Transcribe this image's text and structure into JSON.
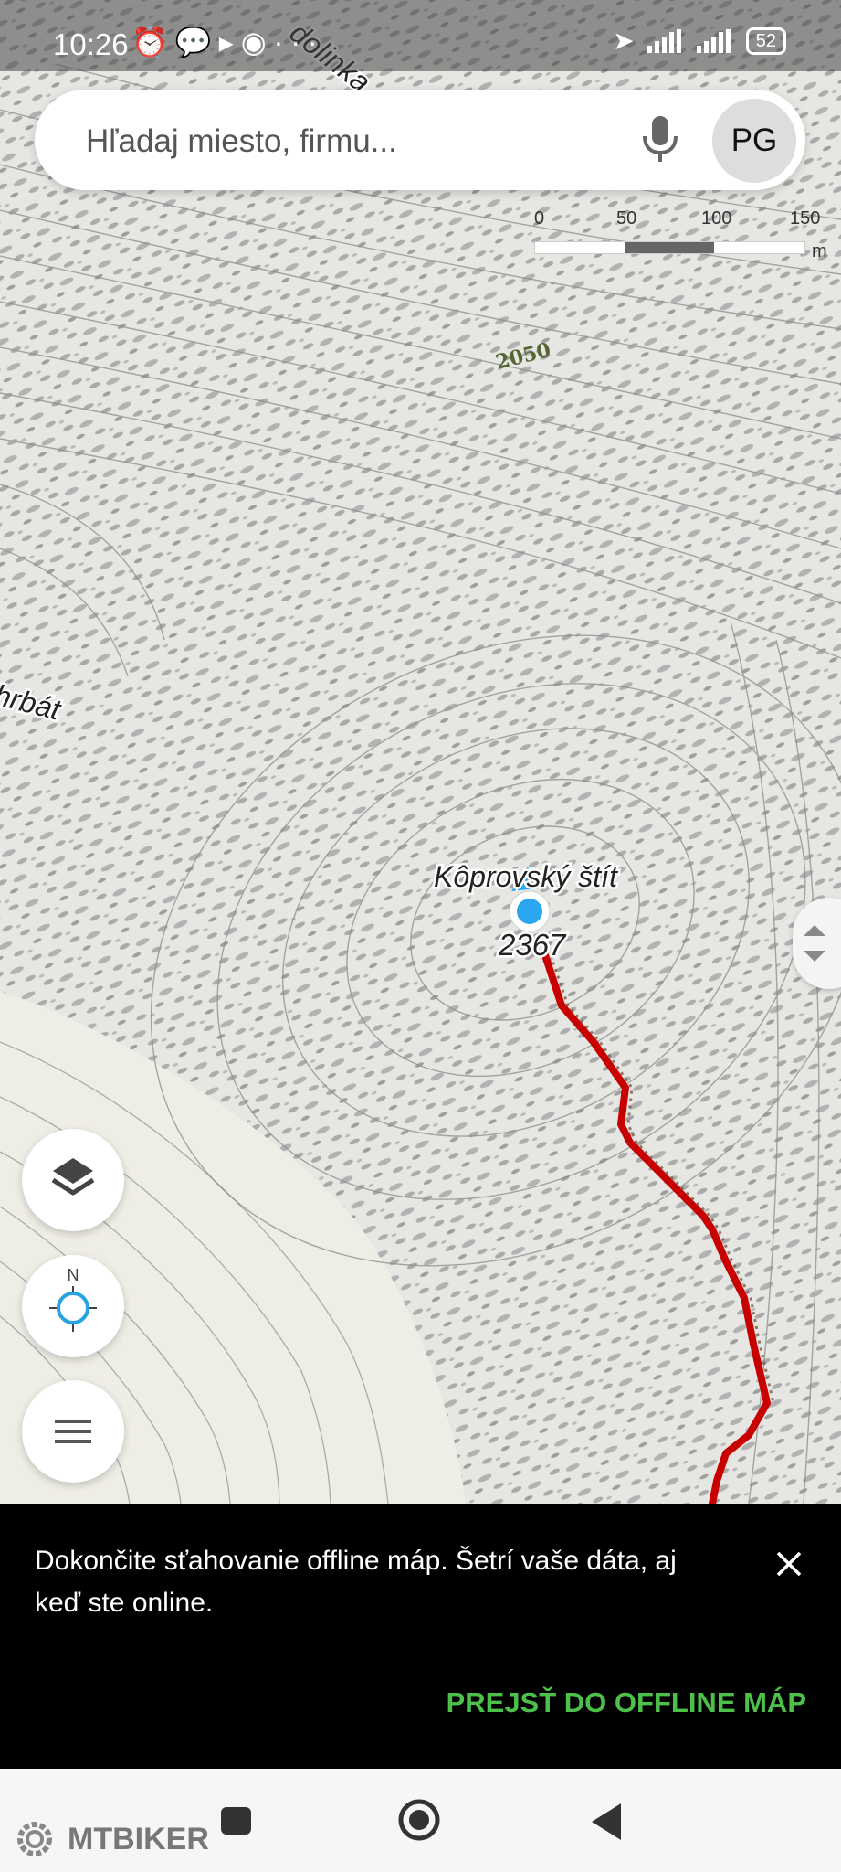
{
  "status_bar": {
    "time": "10:26",
    "icons_left": [
      "alarm-icon",
      "chat-icon",
      "play-icon",
      "record-icon",
      "more-icon"
    ],
    "icons_right": [
      "location-arrow-icon",
      "signal-icon",
      "signal-icon",
      "battery-icon"
    ],
    "battery": "52"
  },
  "search": {
    "placeholder": "Hľadaj miesto, firmu...",
    "avatar_initials": "PG"
  },
  "scale": {
    "labels": [
      "0",
      "50",
      "100",
      "150"
    ],
    "unit": "m"
  },
  "map": {
    "contour_label": "2050",
    "peak_name": "Kôprovský štít",
    "peak_elevation": "2367",
    "partial_labels": [
      "dolinka",
      "hrbát"
    ],
    "route_color": "#c80000",
    "location_dot_color": "#2aa6f0"
  },
  "controls": {
    "layers_icon": "layers-icon",
    "compass_label": "N",
    "menu_icon": "menu-icon"
  },
  "snackbar": {
    "message": "Dokončite sťahovanie offline máp. Šetrí vaše dáta, aj keď ste online.",
    "action": "PREJSŤ DO OFFLINE MÁP",
    "action_color": "#4cc04a"
  },
  "watermark": "MTBIKER"
}
